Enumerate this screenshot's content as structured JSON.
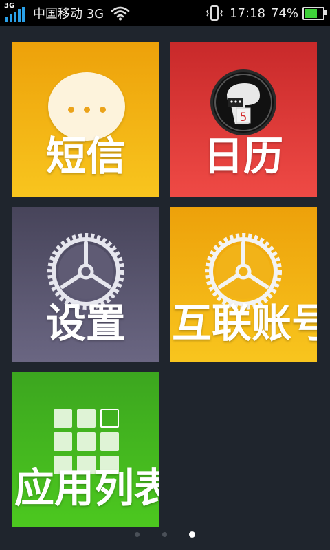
{
  "status_bar": {
    "network": "3G",
    "carrier": "中国移动 3G",
    "time": "17:18",
    "battery_percent_text": "74%",
    "battery_level": 0.74,
    "icons": [
      "signal-icon",
      "wifi-icon",
      "vibrate-icon",
      "battery-icon"
    ]
  },
  "tiles": [
    {
      "label": "短信",
      "icon": "message-bubble-icon",
      "color": "#f3b414"
    },
    {
      "label": "日历",
      "icon": "calendar-icon",
      "color": "#e13a37"
    },
    {
      "label": "设置",
      "icon": "gear-icon",
      "color": "#5a566f"
    },
    {
      "label": "互联账号",
      "icon": "gear-icon",
      "color": "#f3b414"
    },
    {
      "label": "应用列表",
      "icon": "app-grid-icon",
      "color": "#44b81f"
    }
  ],
  "calendar_badge_day": "5",
  "pager": {
    "pages": 3,
    "current": 3
  }
}
